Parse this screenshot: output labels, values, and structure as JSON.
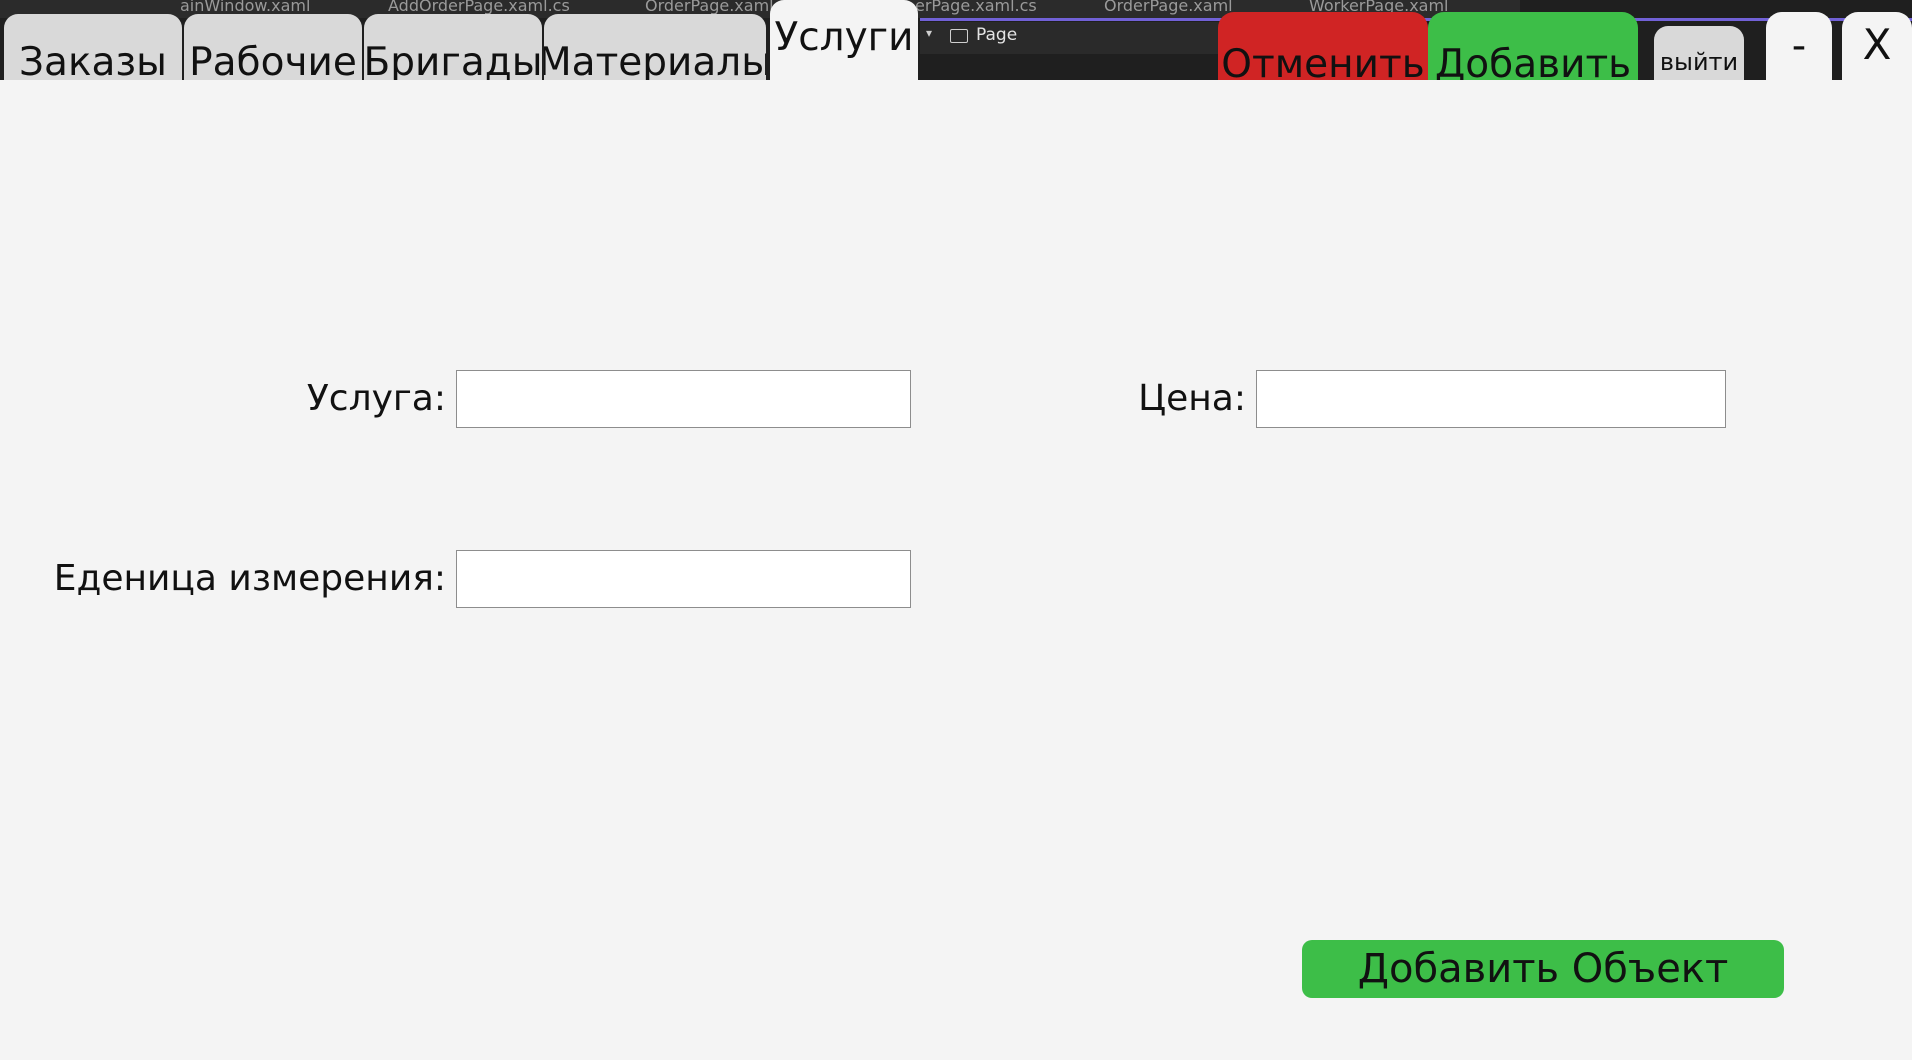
{
  "ide": {
    "file_tabs": [
      {
        "label": "ainWindow.xaml"
      },
      {
        "label": "AddOrderPage.xaml.cs"
      },
      {
        "label": "OrderPage.xaml"
      },
      {
        "label": "erPage.xaml.cs"
      },
      {
        "label": "OrderPage.xaml"
      },
      {
        "label": "WorkerPage.xaml"
      }
    ],
    "toolbar_page_label": "Page",
    "accent_color": "#7161d6"
  },
  "tabs": [
    {
      "label": "Заказы",
      "active": false
    },
    {
      "label": "Рабочие",
      "active": false
    },
    {
      "label": "Бригады",
      "active": false
    },
    {
      "label": "Материалы",
      "active": false
    },
    {
      "label": "Услуги",
      "active": true
    }
  ],
  "header": {
    "cancel_label": "Отменить",
    "add_label": "Добавить",
    "exit_label": "выйти",
    "minimize_label": "-",
    "close_label": "X"
  },
  "form": {
    "service_label": "Услуга:",
    "service_value": "",
    "price_label": "Цена:",
    "price_value": "",
    "unit_label": "Еденица измерения:",
    "unit_value": "",
    "submit_label": "Добавить Объект"
  },
  "colors": {
    "cancel": "#d02424",
    "add": "#3dbe48",
    "tab_inactive": "#d9d9d9",
    "background": "#f4f4f4"
  }
}
